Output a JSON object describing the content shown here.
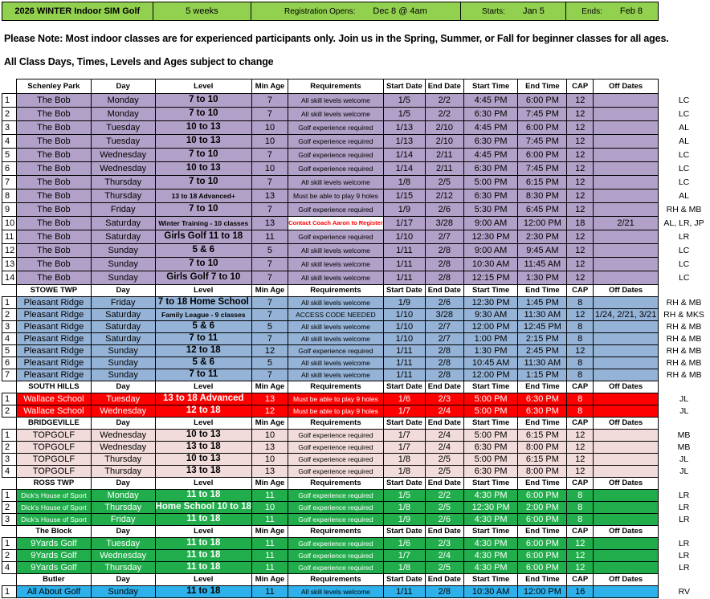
{
  "banner": {
    "title": "2026 WINTER Indoor SIM Golf",
    "duration": "5 weeks",
    "registration_label": "Registration Opens:",
    "registration_value": "Dec 8 @ 4am",
    "starts_label": "Starts:",
    "starts_value": "Jan 5",
    "ends_label": "Ends:",
    "ends_value": "Feb 8"
  },
  "notes": {
    "note1": "Please Note:  Most indoor classes are for experienced participants only.  Join us in the Spring, Summer, or Fall for beginner classes for all ages.",
    "note2": "All Class Days, Times, Levels and Ages subject to change"
  },
  "columns": [
    "Day",
    "Level",
    "Min Age",
    "Requirements",
    "Start Date",
    "End Date",
    "Start Time",
    "End Time",
    "CAP",
    "Off Dates"
  ],
  "colors": {
    "purple": "#b1a0c7",
    "blue": "#95b3d7",
    "red": "#ff0000",
    "pink": "#f2dcdb",
    "green": "#21ad4b",
    "lightblue": "#2eb0ea"
  },
  "sections": [
    {
      "name": "Schenley Park",
      "color": "#b1a0c7",
      "text": "#000000",
      "row_height": 17,
      "rows": [
        {
          "cells": [
            "1",
            "The Bob",
            "Monday",
            "7 to 10",
            "7",
            "All skill levels welcome",
            "1/5",
            "2/2",
            "4:45 PM",
            "6:00 PM",
            "12",
            "",
            "LC"
          ]
        },
        {
          "cells": [
            "2",
            "The Bob",
            "Monday",
            "7 to 10",
            "7",
            "All skill levels welcome",
            "1/5",
            "2/2",
            "6:30 PM",
            "7:45 PM",
            "12",
            "",
            "LC"
          ]
        },
        {
          "cells": [
            "3",
            "The Bob",
            "Tuesday",
            "10 to 13",
            "10",
            "Golf experience required",
            "1/13",
            "2/10",
            "4:45 PM",
            "6:00 PM",
            "12",
            "",
            "AL"
          ]
        },
        {
          "cells": [
            "4",
            "The Bob",
            "Tuesday",
            "10 to 13",
            "10",
            "Golf experience required",
            "1/13",
            "2/10",
            "6:30 PM",
            "7:45 PM",
            "12",
            "",
            "AL"
          ]
        },
        {
          "cells": [
            "5",
            "The Bob",
            "Wednesday",
            "7 to 10",
            "7",
            "Golf experience required",
            "1/14",
            "2/11",
            "4:45 PM",
            "6:00 PM",
            "12",
            "",
            "LC"
          ]
        },
        {
          "cells": [
            "6",
            "The Bob",
            "Wednesday",
            "10 to 13",
            "10",
            "Golf experience required",
            "1/14",
            "2/11",
            "6:30 PM",
            "7:45 PM",
            "12",
            "",
            "LC"
          ]
        },
        {
          "cells": [
            "7",
            "The Bob",
            "Thursday",
            "7 to 10",
            "7",
            "All skill levels welcome",
            "1/8",
            "2/5",
            "5:00 PM",
            "6:15 PM",
            "12",
            "",
            "LC"
          ]
        },
        {
          "cells": [
            "8",
            "The Bob",
            "Thursday",
            "13 to 18 Advanced+",
            "13",
            "Must be able to play 9 holes",
            "1/15",
            "2/12",
            "6:30 PM",
            "8:30 PM",
            "12",
            "",
            "AL"
          ],
          "small_level": true
        },
        {
          "cells": [
            "9",
            "The Bob",
            "Friday",
            "7 to 10",
            "7",
            "Golf experience required",
            "1/9",
            "2/6",
            "5:30 PM",
            "6:45 PM",
            "12",
            "",
            "RH & MB"
          ]
        },
        {
          "cells": [
            "10",
            "The Bob",
            "Saturday",
            "Winter Training - 10 classes",
            "13",
            "Contact Coach Aaron to Register",
            "1/17",
            "3/28",
            "9:00 AM",
            "12:00 PM",
            "18",
            "2/21",
            "AL, LR, JP"
          ],
          "small_level": true,
          "warn_req": true
        },
        {
          "cells": [
            "11",
            "The Bob",
            "Saturday",
            "Girls Golf 11 to 18",
            "11",
            "Golf experience required",
            "1/10",
            "2/7",
            "12:30 PM",
            "2:30 PM",
            "12",
            "",
            "LR"
          ]
        },
        {
          "cells": [
            "12",
            "The Bob",
            "Sunday",
            "5 & 6",
            "5",
            "All skill levels welcome",
            "1/11",
            "2/8",
            "9:00 AM",
            "9:45 AM",
            "12",
            "",
            "LC"
          ]
        },
        {
          "cells": [
            "13",
            "The Bob",
            "Sunday",
            "7 to 10",
            "7",
            "All skill levels welcome",
            "1/11",
            "2/8",
            "10:30 AM",
            "11:45 AM",
            "12",
            "",
            "LC"
          ]
        },
        {
          "cells": [
            "14",
            "The Bob",
            "Sunday",
            "Girls Golf 7 to 10",
            "7",
            "All skill levels welcome",
            "1/11",
            "2/8",
            "12:15 PM",
            "1:30 PM",
            "12",
            "",
            "LC"
          ]
        }
      ]
    },
    {
      "name": "STOWE TWP",
      "color": "#95b3d7",
      "text": "#000000",
      "row_height": 15,
      "rows": [
        {
          "cells": [
            "1",
            "Pleasant Ridge",
            "Friday",
            "7 to 18 Home School",
            "7",
            "All skill levels welcome",
            "1/9",
            "2/6",
            "12:30 PM",
            "1:45 PM",
            "8",
            "",
            "RH & MB"
          ]
        },
        {
          "cells": [
            "2",
            "Pleasant Ridge",
            "Saturday",
            "Family League - 9 classes",
            "7",
            "ACCESS CODE NEEDED",
            "1/10",
            "3/28",
            "9:30 AM",
            "11:30 AM",
            "12",
            "1/24, 2/21, 3/21",
            "RH & MKS"
          ],
          "small_level": true
        },
        {
          "cells": [
            "3",
            "Pleasant Ridge",
            "Saturday",
            "5 & 6",
            "5",
            "All skill levels welcome",
            "1/10",
            "2/7",
            "12:00 PM",
            "12:45 PM",
            "8",
            "",
            "RH & MB"
          ]
        },
        {
          "cells": [
            "4",
            "Pleasant Ridge",
            "Saturday",
            "7 to 11",
            "7",
            "All skill levels welcome",
            "1/10",
            "2/7",
            "1:00 PM",
            "2:15 PM",
            "8",
            "",
            "RH & MB"
          ]
        },
        {
          "cells": [
            "5",
            "Pleasant Ridge",
            "Sunday",
            "12 to 18",
            "12",
            "Golf experience required",
            "1/11",
            "2/8",
            "1:30 PM",
            "2:45 PM",
            "12",
            "",
            "RH & MB"
          ]
        },
        {
          "cells": [
            "6",
            "Pleasant Ridge",
            "Sunday",
            "5 & 6",
            "5",
            "All skill levels welcome",
            "1/11",
            "2/8",
            "10:45 AM",
            "11:30 AM",
            "8",
            "",
            "RH & MB"
          ]
        },
        {
          "cells": [
            "7",
            "Pleasant Ridge",
            "Sunday",
            "7 to 11",
            "7",
            "All skill levels welcome",
            "1/11",
            "2/8",
            "12:00 PM",
            "1:15 PM",
            "8",
            "",
            "RH & MB"
          ]
        }
      ]
    },
    {
      "name": "SOUTH HILLS",
      "color": "#ff0000",
      "text": "#ffffff",
      "row_height": 15,
      "rows": [
        {
          "cells": [
            "1",
            "Wallace School",
            "Tuesday",
            "13 to 18 Advanced",
            "13",
            "Must be able to play 9 holes",
            "1/6",
            "2/3",
            "5:00 PM",
            "6:30 PM",
            "8",
            "",
            "JL"
          ]
        },
        {
          "cells": [
            "2",
            "Wallace School",
            "Wednesday",
            "12 to 18",
            "12",
            "Must be able to play 9 holes",
            "1/7",
            "2/4",
            "5:00 PM",
            "6:30 PM",
            "8",
            "",
            "JL"
          ]
        }
      ]
    },
    {
      "name": "BRIDGEVILLE",
      "color": "#f2dcdb",
      "text": "#000000",
      "row_height": 15,
      "rows": [
        {
          "cells": [
            "1",
            "TOPGOLF",
            "Wednesday",
            "10 to 13",
            "10",
            "Golf experience required",
            "1/7",
            "2/4",
            "5:00 PM",
            "6:15 PM",
            "12",
            "",
            "MB"
          ]
        },
        {
          "cells": [
            "2",
            "TOPGOLF",
            "Wednesday",
            "13 to 18",
            "13",
            "Golf experience required",
            "1/7",
            "2/4",
            "6:30 PM",
            "8:00 PM",
            "12",
            "",
            "MB"
          ]
        },
        {
          "cells": [
            "3",
            "TOPGOLF",
            "Thursday",
            "10 to 13",
            "10",
            "Golf experience required",
            "1/8",
            "2/5",
            "5:00 PM",
            "6:15 PM",
            "12",
            "",
            "JL"
          ]
        },
        {
          "cells": [
            "4",
            "TOPGOLF",
            "Thursday",
            "13 to 18",
            "13",
            "Golf experience required",
            "1/8",
            "2/5",
            "6:30 PM",
            "8:00 PM",
            "12",
            "",
            "JL"
          ]
        }
      ]
    },
    {
      "name": "ROSS TWP",
      "color": "#21ad4b",
      "text": "#ffffff",
      "row_height": 15,
      "rows": [
        {
          "cells": [
            "1",
            "Dick's House of Sport",
            "Monday",
            "11 to 18",
            "11",
            "Golf experience required",
            "1/5",
            "2/2",
            "4:30 PM",
            "6:00 PM",
            "8",
            "",
            "LR"
          ]
        },
        {
          "cells": [
            "2",
            "Dick's House of Sport",
            "Thursday",
            "Home School 10 to 18",
            "10",
            "Golf experience required",
            "1/8",
            "2/5",
            "12:30 PM",
            "2:00 PM",
            "8",
            "",
            "LR"
          ]
        },
        {
          "cells": [
            "3",
            "Dick's House of Sport",
            "Friday",
            "11 to 18",
            "11",
            "Golf experience required",
            "1/9",
            "2/6",
            "4:30 PM",
            "6:00 PM",
            "8",
            "",
            "LR"
          ]
        }
      ]
    },
    {
      "name": "The Block",
      "color": "#21ad4b",
      "text": "#ffffff",
      "row_height": 15,
      "rows": [
        {
          "cells": [
            "1",
            "9Yards Golf",
            "Tuesday",
            "11 to 18",
            "11",
            "Golf experience required",
            "1/6",
            "2/3",
            "4:30 PM",
            "6:00 PM",
            "12",
            "",
            "LR"
          ]
        },
        {
          "cells": [
            "2",
            "9Yards Golf",
            "Wednesday",
            "11 to 18",
            "11",
            "Golf experience required",
            "1/7",
            "2/4",
            "4:30 PM",
            "6:00 PM",
            "12",
            "",
            "LR"
          ]
        },
        {
          "cells": [
            "4",
            "9Yards Golf",
            "Thursday",
            "11 to 18",
            "11",
            "Golf experience required",
            "1/8",
            "2/5",
            "4:30 PM",
            "6:00 PM",
            "12",
            "",
            "LR"
          ]
        }
      ]
    },
    {
      "name": "Butler",
      "color": "#2eb0ea",
      "text": "#000000",
      "row_height": 15,
      "rows": [
        {
          "cells": [
            "1",
            "All About Golf",
            "Sunday",
            "11 to 18",
            "11",
            "All skill levels welcome",
            "1/11",
            "2/8",
            "10:30 AM",
            "12:00 PM",
            "16",
            "",
            "RV"
          ]
        }
      ]
    }
  ]
}
